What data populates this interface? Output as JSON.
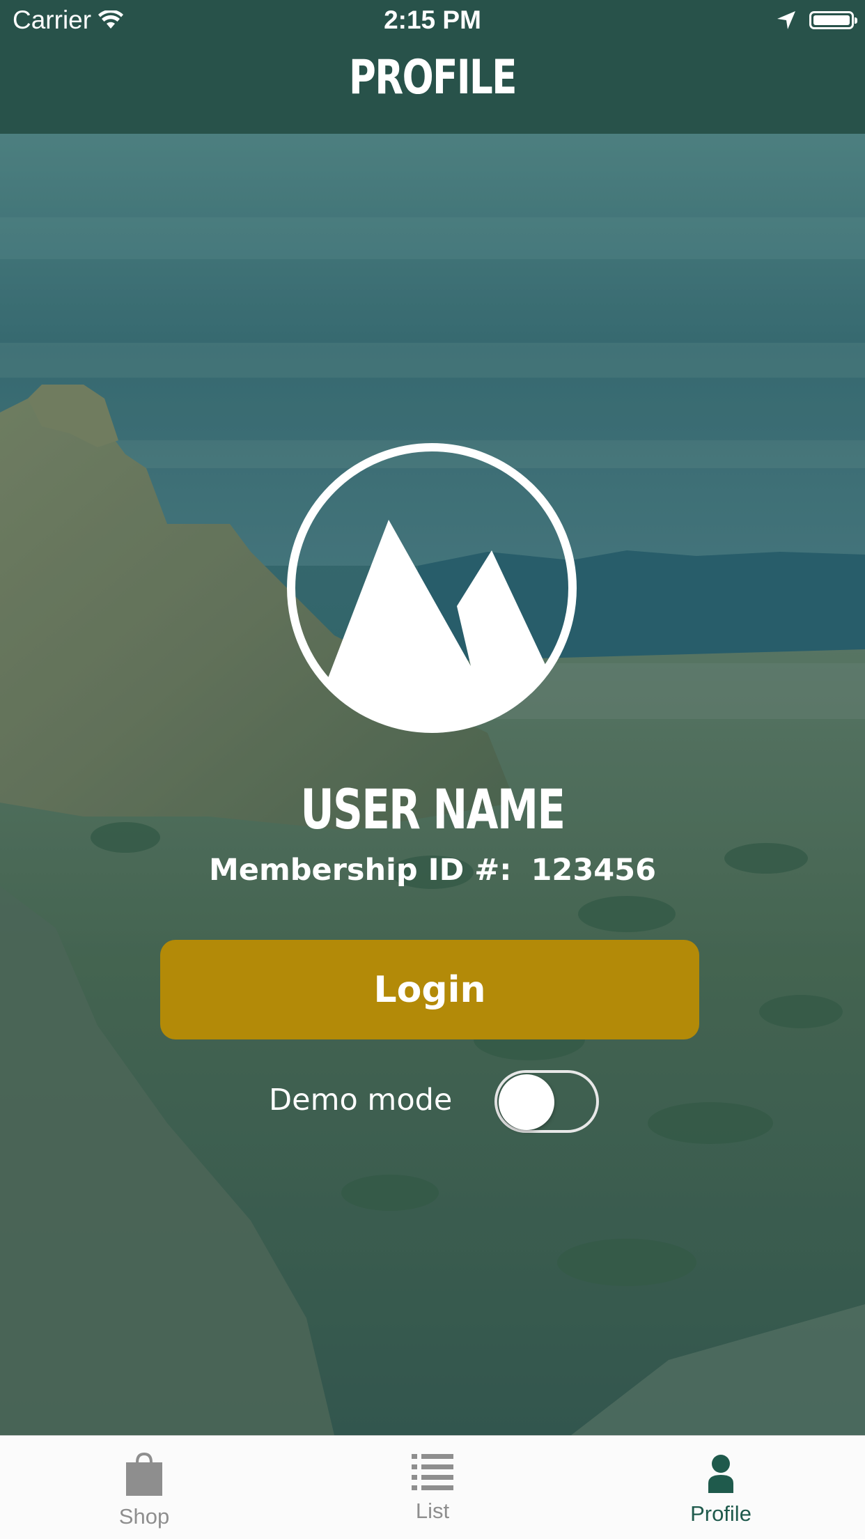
{
  "status_bar": {
    "carrier": "Carrier",
    "time": "2:15 PM",
    "icons": [
      "wifi-icon",
      "location-arrow-icon",
      "battery-icon"
    ]
  },
  "header": {
    "title": "PROFILE"
  },
  "profile": {
    "logo_icon": "mountain-logo-icon",
    "user_name": "USER NAME",
    "membership_label": "Membership ID #:",
    "membership_id": "123456"
  },
  "actions": {
    "login_label": "Login",
    "demo_mode_label": "Demo mode",
    "demo_mode_on": false
  },
  "tab_bar": {
    "tabs": [
      {
        "label": "Shop",
        "icon": "shopping-bag-icon",
        "active": false
      },
      {
        "label": "List",
        "icon": "list-icon",
        "active": false
      },
      {
        "label": "Profile",
        "icon": "person-icon",
        "active": true
      }
    ]
  },
  "colors": {
    "header": "#28524a",
    "login_button": "#b38a08",
    "tab_active": "#1f5a4c",
    "tab_inactive": "#8e8e8e"
  }
}
